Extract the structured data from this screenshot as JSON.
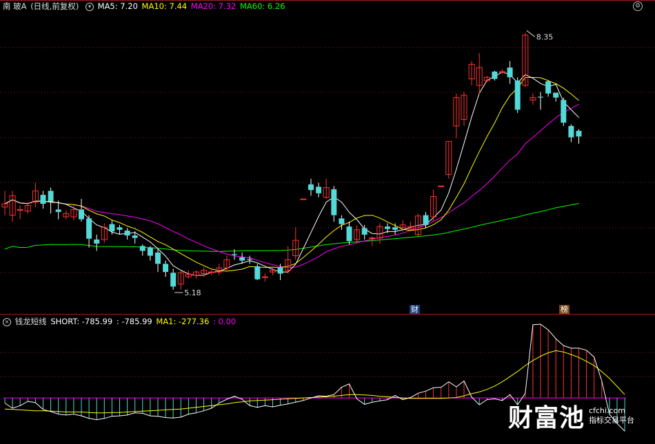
{
  "header": {
    "stock_name": "南 玻A",
    "period": "(日线,前复权)",
    "ma5_label": "MA5: 7.20",
    "ma10_label": "MA10: 7.44",
    "ma20_label": "MA20: 7.32",
    "ma60_label": "MA60: 6.26"
  },
  "indicator_header": {
    "name": "钱龙短线",
    "short_label": "SHORT: -785.99",
    "value2_label": ": -785.99",
    "ma1_label": "MA1: -277.36",
    "value4_label": ": 0.00"
  },
  "annotations": {
    "high_label": "8.35",
    "low_label": "5.18",
    "badge_cai": "财",
    "badge_bang": "榜"
  },
  "watermark": {
    "big": "财富池",
    "site": "cfchi.com",
    "tagline": "指标交易平台"
  },
  "colors": {
    "up": "#ff3333",
    "down": "#54d8d8",
    "ma5": "#ffffff",
    "ma10": "#ffff00",
    "ma20": "#ff00ff",
    "ma60": "#00ff00",
    "ind_pos": "#ff3333",
    "ind_neg": "#54d8d8",
    "short": "#ffffff",
    "ma1": "#ffff00",
    "zero": "#ff00ff",
    "grid": "#8a1f1f"
  },
  "chart_data": {
    "type": "candlestick",
    "price_axis_range": [
      4.9,
      8.6
    ],
    "candles": [
      [
        6.2,
        6.24,
        6.1,
        6.4
      ],
      [
        6.1,
        6.34,
        6.02,
        6.4
      ],
      [
        6.16,
        6.17,
        6.05,
        6.22
      ],
      [
        6.15,
        6.22,
        6.12,
        6.26
      ],
      [
        6.26,
        6.4,
        6.2,
        6.5
      ],
      [
        6.35,
        6.24,
        6.18,
        6.4
      ],
      [
        6.4,
        6.27,
        6.12,
        6.44
      ],
      [
        6.17,
        6.14,
        6.05,
        6.28
      ],
      [
        6.08,
        6.12,
        6.05,
        6.16
      ],
      [
        6.08,
        6.17,
        6.04,
        6.22
      ],
      [
        6.17,
        6.05,
        6.02,
        6.3
      ],
      [
        6.06,
        5.81,
        5.7,
        6.1
      ],
      [
        5.8,
        5.75,
        5.66,
        5.86
      ],
      [
        5.8,
        5.95,
        5.76,
        6.0
      ],
      [
        5.99,
        5.9,
        5.86,
        6.04
      ],
      [
        5.95,
        5.92,
        5.86,
        5.98
      ],
      [
        5.91,
        5.85,
        5.8,
        5.94
      ],
      [
        5.85,
        5.82,
        5.75,
        5.9
      ],
      [
        5.72,
        5.66,
        5.6,
        5.74
      ],
      [
        5.7,
        5.6,
        5.54,
        5.72
      ],
      [
        5.64,
        5.5,
        5.4,
        5.68
      ],
      [
        5.5,
        5.4,
        5.34,
        5.54
      ],
      [
        5.39,
        5.22,
        5.18,
        5.44
      ],
      [
        5.25,
        5.39,
        5.18,
        5.42
      ],
      [
        5.34,
        5.37,
        5.32,
        5.42
      ],
      [
        5.36,
        5.4,
        5.32,
        5.42
      ],
      [
        5.38,
        5.42,
        5.34,
        5.46
      ],
      [
        5.4,
        5.4,
        5.36,
        5.44
      ],
      [
        5.4,
        5.45,
        5.36,
        5.5
      ],
      [
        5.45,
        5.55,
        5.4,
        5.6
      ],
      [
        5.62,
        5.61,
        5.55,
        5.68
      ],
      [
        5.58,
        5.54,
        5.5,
        5.64
      ],
      [
        5.56,
        5.55,
        5.5,
        5.6
      ],
      [
        5.47,
        5.31,
        5.3,
        5.5
      ],
      [
        5.34,
        5.34,
        5.28,
        5.38
      ],
      [
        5.4,
        5.42,
        5.36,
        5.46
      ],
      [
        5.46,
        5.38,
        5.3,
        5.5
      ],
      [
        5.42,
        5.55,
        5.38,
        5.72
      ],
      [
        5.6,
        5.79,
        5.55,
        5.95
      ],
      [
        6.3,
        6.3,
        6.3,
        6.3
      ],
      [
        6.48,
        6.41,
        6.34,
        6.55
      ],
      [
        6.45,
        6.37,
        6.32,
        6.5
      ],
      [
        6.32,
        6.44,
        6.3,
        6.55
      ],
      [
        6.42,
        6.1,
        6.02,
        6.46
      ],
      [
        6.06,
        5.99,
        5.92,
        6.1
      ],
      [
        5.96,
        5.78,
        5.74,
        6.02
      ],
      [
        5.8,
        5.92,
        5.75,
        5.98
      ],
      [
        5.94,
        5.86,
        5.8,
        5.98
      ],
      [
        5.82,
        5.82,
        5.72,
        5.84
      ],
      [
        5.82,
        5.96,
        5.75,
        6.0
      ],
      [
        5.96,
        5.93,
        5.88,
        6.0
      ],
      [
        5.95,
        5.92,
        5.86,
        6.0
      ],
      [
        5.95,
        5.98,
        5.9,
        6.04
      ],
      [
        5.93,
        5.96,
        5.9,
        6.02
      ],
      [
        5.86,
        6.09,
        5.84,
        6.12
      ],
      [
        6.1,
        5.98,
        5.94,
        6.14
      ],
      [
        6.08,
        6.33,
        6.02,
        6.42
      ],
      [
        6.46,
        6.46,
        6.46,
        6.46
      ],
      [
        6.6,
        7.01,
        6.55,
        7.0
      ],
      [
        7.2,
        7.55,
        7.05,
        7.6
      ],
      [
        7.28,
        7.58,
        7.2,
        7.62
      ],
      [
        7.78,
        7.96,
        7.7,
        8.0
      ],
      [
        7.7,
        7.92,
        7.6,
        8.1
      ],
      [
        7.76,
        7.8,
        7.74,
        7.82
      ],
      [
        7.87,
        7.78,
        7.76,
        7.88
      ],
      [
        7.86,
        7.87,
        7.84,
        7.9
      ],
      [
        7.92,
        7.8,
        7.72,
        8.0
      ],
      [
        7.76,
        7.4,
        7.36,
        7.8
      ],
      [
        7.7,
        8.32,
        7.68,
        8.35
      ],
      [
        7.52,
        7.55,
        7.46,
        7.6
      ],
      [
        7.56,
        7.55,
        7.4,
        7.62
      ],
      [
        7.75,
        7.6,
        7.56,
        7.76
      ],
      [
        7.61,
        7.55,
        7.5,
        7.6
      ],
      [
        7.52,
        7.24,
        7.2,
        7.55
      ],
      [
        7.2,
        7.06,
        7.0,
        7.22
      ],
      [
        7.14,
        7.07,
        6.98,
        7.16
      ]
    ],
    "indicator_axis_range": [
      -1000,
      1650
    ],
    "short_series": [
      -120,
      -240,
      -180,
      -80,
      -110,
      -270,
      -320,
      -380,
      -400,
      -380,
      -420,
      -480,
      -510,
      -480,
      -430,
      -420,
      -400,
      -350,
      -360,
      -420,
      -430,
      -460,
      -470,
      -450,
      -380,
      -350,
      -300,
      -240,
      -120,
      -30,
      40,
      -30,
      -180,
      -220,
      -180,
      -210,
      -170,
      -140,
      -100,
      -60,
      0,
      50,
      40,
      80,
      250,
      330,
      -20,
      -150,
      -100,
      -70,
      -40,
      60,
      -40,
      10,
      110,
      160,
      240,
      250,
      380,
      260,
      400,
      20,
      -160,
      -40,
      -20,
      -60,
      80,
      -160,
      110,
      1720,
      1730,
      1600,
      1390,
      1230,
      1170,
      1170,
      1120,
      960,
      400,
      -380,
      -600,
      -780
    ],
    "ma1_series": [
      -260,
      -270,
      -280,
      -290,
      -300,
      -300,
      -310,
      -320,
      -330,
      -330,
      -330,
      -340,
      -350,
      -350,
      -340,
      -340,
      -330,
      -320,
      -310,
      -300,
      -290,
      -280,
      -270,
      -260,
      -240,
      -220,
      -200,
      -180,
      -160,
      -140,
      -110,
      -90,
      -70,
      -60,
      -50,
      -40,
      -30,
      -20,
      -10,
      0,
      10,
      20,
      30,
      40,
      60,
      80,
      80,
      70,
      60,
      40,
      30,
      10,
      0,
      -10,
      -10,
      -10,
      -10,
      -10,
      0,
      10,
      50,
      100,
      140,
      200,
      280,
      380,
      500,
      620,
      760,
      880,
      980,
      1060,
      1110,
      1080,
      1020,
      950,
      860,
      760,
      620,
      460,
      270,
      80
    ],
    "zero_line": 0
  }
}
